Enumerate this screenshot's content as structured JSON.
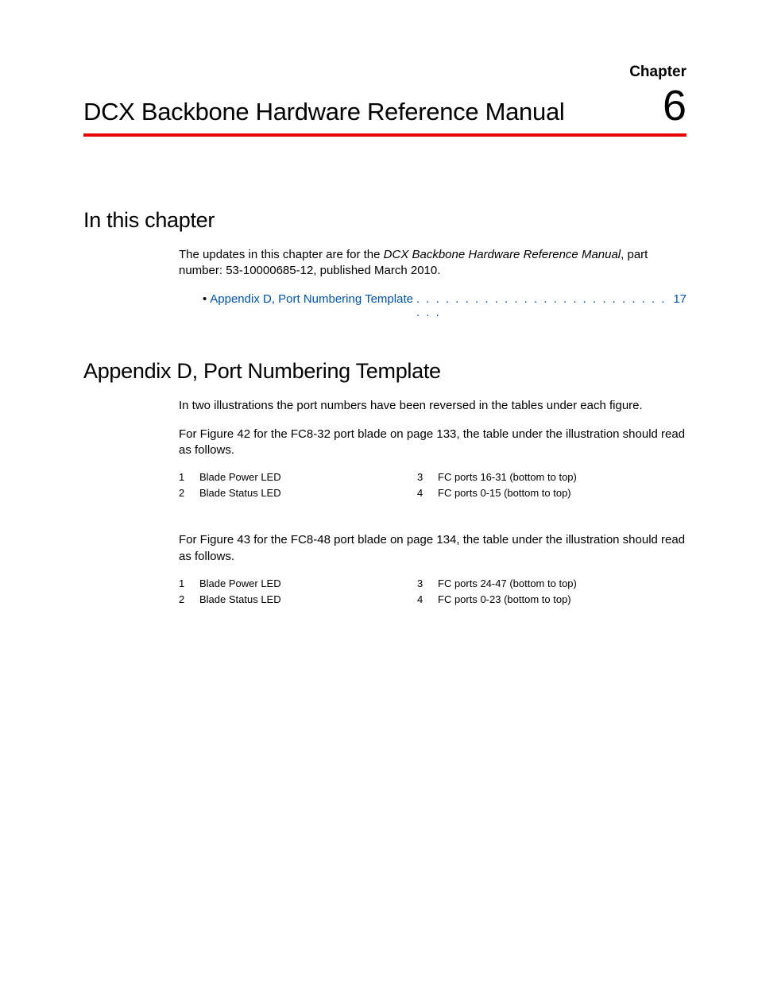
{
  "header": {
    "chapter_label": "Chapter",
    "title": "DCX Backbone Hardware Reference Manual",
    "chapter_number": "6"
  },
  "section1": {
    "heading": "In this chapter",
    "intro_prefix": "The updates in this chapter are for the ",
    "intro_italic": "DCX Backbone Hardware Reference Manual",
    "intro_suffix": ", part number: 53-10000685-12, published March 2010.",
    "toc": {
      "bullet": "•",
      "link_text": "Appendix D, Port Numbering Template",
      "dots": " . . . . . . . . . . . . . . . . . . . . . . . . . . . . .  ",
      "page": "17"
    }
  },
  "section2": {
    "heading": "Appendix D, Port Numbering Template",
    "p1": "In two illustrations the port numbers have been reversed in the tables under each figure.",
    "p2": "For Figure 42 for the FC8-32 port blade on page 133, the table under the illustration should read as follows.",
    "table1": {
      "r1": {
        "n1": "1",
        "l1": "Blade Power LED",
        "n2": "3",
        "l2": "FC ports 16-31 (bottom to top)"
      },
      "r2": {
        "n1": "2",
        "l1": "Blade Status LED",
        "n2": "4",
        "l2": "FC ports 0-15 (bottom to top)"
      }
    },
    "p3": "For Figure 43 for the FC8-48 port blade on page 134, the table under the illustration should read as follows.",
    "table2": {
      "r1": {
        "n1": "1",
        "l1": "Blade Power LED",
        "n2": "3",
        "l2": "FC ports 24-47 (bottom to top)"
      },
      "r2": {
        "n1": "2",
        "l1": "Blade Status LED",
        "n2": "4",
        "l2": "FC ports 0-23 (bottom to top)"
      }
    }
  }
}
